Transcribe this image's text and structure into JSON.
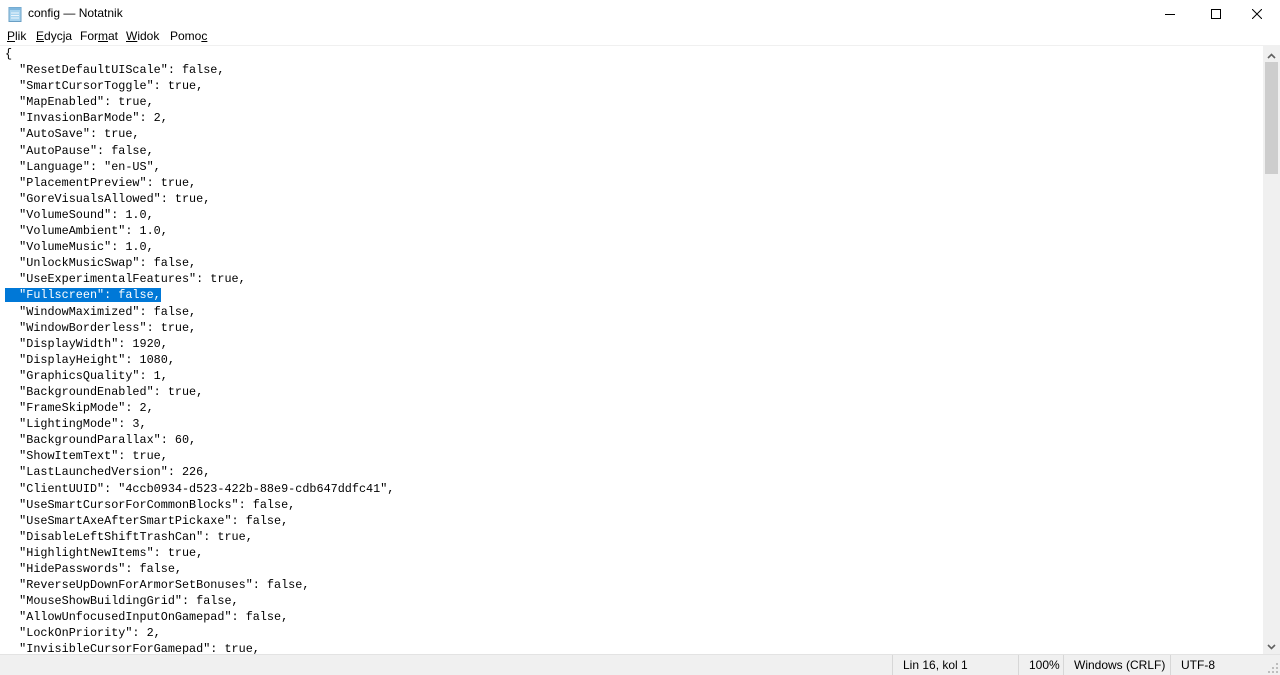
{
  "window": {
    "title": "config — Notatnik",
    "app_icon": "notepad-icon",
    "controls": {
      "minimize": "minimize-icon",
      "maximize": "maximize-icon",
      "close": "close-icon"
    }
  },
  "menu": [
    {
      "label": "Plik",
      "accel": "P",
      "rest": "lik"
    },
    {
      "label": "Edycja",
      "accel": "E",
      "rest": "dycja"
    },
    {
      "label": "Format",
      "pre": "For",
      "accel": "m",
      "rest": "at"
    },
    {
      "label": "Widok",
      "accel": "W",
      "rest": "idok"
    },
    {
      "label": "Pomoc",
      "pre": "Pomo",
      "accel": "c",
      "rest": ""
    }
  ],
  "editor": {
    "selected_line_index": 15,
    "lines": [
      "{",
      "  \"ResetDefaultUIScale\": false,",
      "  \"SmartCursorToggle\": true,",
      "  \"MapEnabled\": true,",
      "  \"InvasionBarMode\": 2,",
      "  \"AutoSave\": true,",
      "  \"AutoPause\": false,",
      "  \"Language\": \"en-US\",",
      "  \"PlacementPreview\": true,",
      "  \"GoreVisualsAllowed\": true,",
      "  \"VolumeSound\": 1.0,",
      "  \"VolumeAmbient\": 1.0,",
      "  \"VolumeMusic\": 1.0,",
      "  \"UnlockMusicSwap\": false,",
      "  \"UseExperimentalFeatures\": true,",
      "  \"Fullscreen\": false,",
      "  \"WindowMaximized\": false,",
      "  \"WindowBorderless\": true,",
      "  \"DisplayWidth\": 1920,",
      "  \"DisplayHeight\": 1080,",
      "  \"GraphicsQuality\": 1,",
      "  \"BackgroundEnabled\": true,",
      "  \"FrameSkipMode\": 2,",
      "  \"LightingMode\": 3,",
      "  \"BackgroundParallax\": 60,",
      "  \"ShowItemText\": true,",
      "  \"LastLaunchedVersion\": 226,",
      "  \"ClientUUID\": \"4ccb0934-d523-422b-88e9-cdb647ddfc41\",",
      "  \"UseSmartCursorForCommonBlocks\": false,",
      "  \"UseSmartAxeAfterSmartPickaxe\": false,",
      "  \"DisableLeftShiftTrashCan\": true,",
      "  \"HighlightNewItems\": true,",
      "  \"HidePasswords\": false,",
      "  \"ReverseUpDownForArmorSetBonuses\": false,",
      "  \"MouseShowBuildingGrid\": false,",
      "  \"AllowUnfocusedInputOnGamepad\": false,",
      "  \"LockOnPriority\": 2,",
      "  \"InvisibleCursorForGamepad\": true,"
    ]
  },
  "scrollbar": {
    "up_icon": "chevron-up-icon",
    "down_icon": "chevron-down-icon",
    "scroll_position_fraction": 0.0
  },
  "status": {
    "position": "Lin 16, kol 1",
    "zoom": "100%",
    "line_ending": "Windows (CRLF)",
    "encoding": "UTF-8"
  },
  "colors": {
    "selection": "#0078d7",
    "selection_text": "#ffffff",
    "statusbar_bg": "#f0f0f0",
    "scroll_thumb": "#cdcdcd"
  }
}
